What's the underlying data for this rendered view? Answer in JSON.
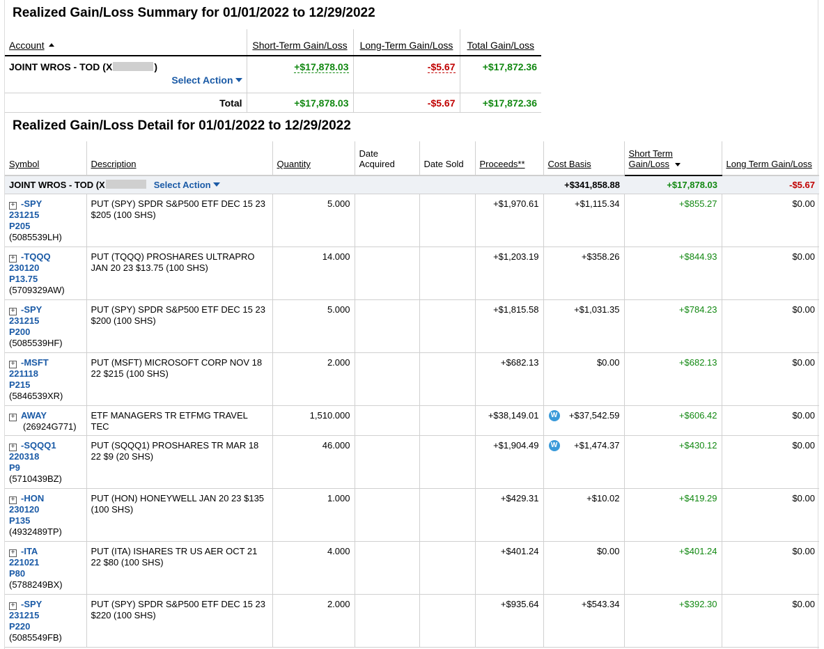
{
  "summary": {
    "title": "Realized Gain/Loss Summary for 01/01/2022 to 12/29/2022",
    "headers": {
      "account": "Account",
      "short_term": "Short-Term Gain/Loss",
      "long_term": "Long-Term Gain/Loss",
      "total": "Total Gain/Loss"
    },
    "account_prefix": "JOINT WROS - TOD (X",
    "account_suffix": ")",
    "select_action": "Select Action",
    "account_values": {
      "short_term": "+$17,878.03",
      "long_term": "-$5.67",
      "total": "+$17,872.36"
    },
    "total_label": "Total",
    "total_values": {
      "short_term": "+$17,878.03",
      "long_term": "-$5.67",
      "total": "+$17,872.36"
    }
  },
  "detail": {
    "title": "Realized Gain/Loss Detail for 01/01/2022 to 12/29/2022",
    "headers": {
      "symbol": "Symbol",
      "description": "Description",
      "quantity": "Quantity",
      "date_acquired_1": "Date",
      "date_acquired_2": "Acquired",
      "date_sold": "Date Sold",
      "proceeds": "Proceeds**",
      "cost_basis": "Cost Basis",
      "short_term_1": "Short Term",
      "short_term_2": "Gain/Loss",
      "long_term": "Long Term Gain/Loss"
    },
    "account_row": {
      "prefix": "JOINT WROS - TOD (X",
      "select_action": "Select Action",
      "cost_basis": "+$341,858.88",
      "short_term": "+$17,878.03",
      "long_term": "-$5.67"
    },
    "rows": [
      {
        "sym": [
          "-SPY",
          "231215",
          "P205"
        ],
        "cusip": "(5085539LH)",
        "desc": "PUT (SPY) SPDR S&P500 ETF DEC 15 23 $205 (100 SHS)",
        "qty": "5.000",
        "proceeds": "+$1,970.61",
        "w": false,
        "cost": "+$1,115.34",
        "st": "+$855.27",
        "lt": "$0.00"
      },
      {
        "sym": [
          "-TQQQ",
          "230120",
          "P13.75"
        ],
        "cusip": "(5709329AW)",
        "desc": "PUT (TQQQ) PROSHARES ULTRAPRO JAN 20 23 $13.75 (100 SHS)",
        "qty": "14.000",
        "proceeds": "+$1,203.19",
        "w": false,
        "cost": "+$358.26",
        "st": "+$844.93",
        "lt": "$0.00"
      },
      {
        "sym": [
          "-SPY",
          "231215",
          "P200"
        ],
        "cusip": "(5085539HF)",
        "desc": "PUT (SPY) SPDR S&P500 ETF DEC 15 23 $200 (100 SHS)",
        "qty": "5.000",
        "proceeds": "+$1,815.58",
        "w": false,
        "cost": "+$1,031.35",
        "st": "+$784.23",
        "lt": "$0.00"
      },
      {
        "sym": [
          "-MSFT",
          "221118",
          "P215"
        ],
        "cusip": "(5846539XR)",
        "desc": "PUT (MSFT) MICROSOFT CORP NOV 18 22 $215 (100 SHS)",
        "qty": "2.000",
        "proceeds": "+$682.13",
        "w": false,
        "cost": "$0.00",
        "st": "+$682.13",
        "lt": "$0.00"
      },
      {
        "sym": [
          "AWAY"
        ],
        "cusip": "(26924G771)",
        "desc": "ETF MANAGERS TR ETFMG TRAVEL TEC",
        "qty": "1,510.000",
        "proceeds": "+$38,149.01",
        "w": true,
        "cost": "+$37,542.59",
        "st": "+$606.42",
        "lt": "$0.00"
      },
      {
        "sym": [
          "-SQQQ1",
          "220318",
          "P9"
        ],
        "cusip": "(5710439BZ)",
        "desc": "PUT (SQQQ1) PROSHARES TR MAR 18 22 $9 (20 SHS)",
        "qty": "46.000",
        "proceeds": "+$1,904.49",
        "w": true,
        "cost": "+$1,474.37",
        "st": "+$430.12",
        "lt": "$0.00"
      },
      {
        "sym": [
          "-HON",
          "230120",
          "P135"
        ],
        "cusip": "(4932489TP)",
        "desc": "PUT (HON) HONEYWELL JAN 20 23 $135 (100 SHS)",
        "qty": "1.000",
        "proceeds": "+$429.31",
        "w": false,
        "cost": "+$10.02",
        "st": "+$419.29",
        "lt": "$0.00"
      },
      {
        "sym": [
          "-ITA",
          "221021",
          "P80"
        ],
        "cusip": "(5788249BX)",
        "desc": "PUT (ITA) ISHARES TR US AER OCT 21 22 $80 (100 SHS)",
        "qty": "4.000",
        "proceeds": "+$401.24",
        "w": false,
        "cost": "$0.00",
        "st": "+$401.24",
        "lt": "$0.00"
      },
      {
        "sym": [
          "-SPY",
          "231215",
          "P220"
        ],
        "cusip": "(5085549FB)",
        "desc": "PUT (SPY) SPDR S&P500 ETF DEC 15 23 $220 (100 SHS)",
        "qty": "2.000",
        "proceeds": "+$935.64",
        "w": false,
        "cost": "+$543.34",
        "st": "+$392.30",
        "lt": "$0.00"
      }
    ],
    "wash_icon_letter": "W",
    "expand_glyph": "+"
  },
  "colors": {
    "gain": "#118811",
    "loss": "#c00000",
    "link": "#1a5aa6"
  }
}
